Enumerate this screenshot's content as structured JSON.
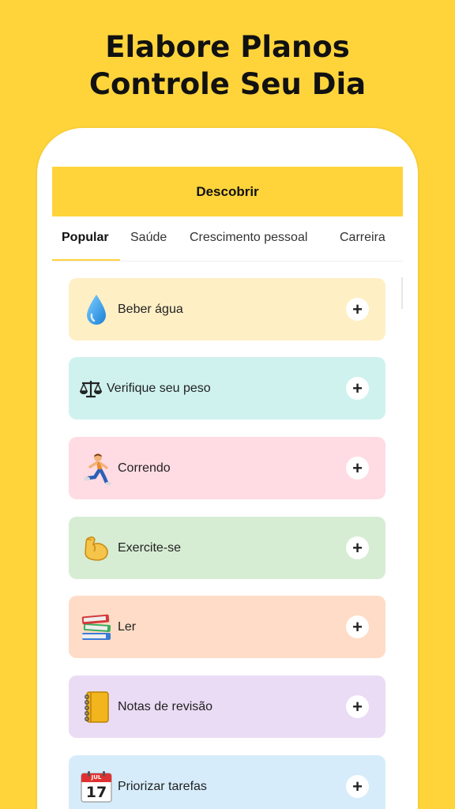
{
  "headline": {
    "line1": "Elabore Planos",
    "line2": "Controle Seu Dia"
  },
  "appbar": {
    "title": "Descobrir"
  },
  "tabs": [
    {
      "label": "Popular",
      "active": true
    },
    {
      "label": "Saúde"
    },
    {
      "label": "Crescimento pessoal"
    },
    {
      "label": "Carreira"
    }
  ],
  "habits": [
    {
      "label": "Beber água",
      "icon": "water-drop-icon",
      "color": "#FFEFC5"
    },
    {
      "label": "Verifique seu peso",
      "icon": "scales-icon",
      "color": "#CFF2EF"
    },
    {
      "label": "Correndo",
      "icon": "runner-icon",
      "color": "#FFDCE3"
    },
    {
      "label": "Exercite-se",
      "icon": "flexed-biceps-icon",
      "color": "#D6EDD3"
    },
    {
      "label": "Ler",
      "icon": "books-icon",
      "color": "#FFDCC7"
    },
    {
      "label": "Notas de revisão",
      "icon": "notebook-icon",
      "color": "#EADCF5"
    },
    {
      "label": "Priorizar tarefas",
      "icon": "calendar-icon",
      "color": "#D6ECFB"
    }
  ],
  "calendar_icon": {
    "month": "JUL",
    "day": "17"
  },
  "add_symbol": "+"
}
